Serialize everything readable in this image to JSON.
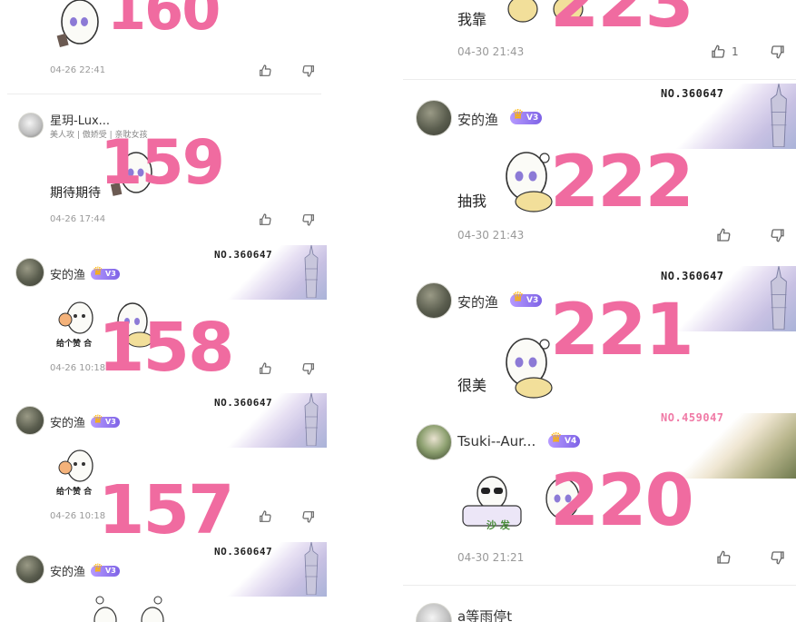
{
  "left_column": {
    "comments": [
      {
        "number": "160",
        "time": "04-26 22:41"
      },
      {
        "user": "星玥-Lux...",
        "tags": "美人攻 | 傲娇受 | 亲耽女孩",
        "text": "期待期待",
        "number": "159",
        "time": "04-26 17:44"
      },
      {
        "user": "安的渔",
        "level": "V3",
        "deco_no": "NO.360647",
        "number": "158",
        "time": "04-26 10:18",
        "sticker_text": "给个赞 合"
      },
      {
        "user": "安的渔",
        "level": "V3",
        "deco_no": "NO.360647",
        "number": "157",
        "time": "04-26 10:18",
        "sticker_text": "给个赞 合"
      },
      {
        "user": "安的渔",
        "level": "V3",
        "deco_no": "NO.360647"
      }
    ]
  },
  "right_column": {
    "comments": [
      {
        "text": "我靠",
        "number": "223",
        "time": "04-30 21:43",
        "like_count": "1"
      },
      {
        "user": "安的渔",
        "level": "V3",
        "deco_no": "NO.360647",
        "text": "抽我",
        "number": "222",
        "time": "04-30 21:43"
      },
      {
        "user": "安的渔",
        "level": "V3",
        "deco_no": "NO.360647",
        "text": "很美",
        "number": "221"
      },
      {
        "user": "Tsuki--Aur...",
        "level": "V4",
        "deco_no": "NO.459047",
        "number": "220",
        "time": "04-30 21:21",
        "sticker_text": "沙 发"
      },
      {
        "user": "a等雨停t"
      }
    ]
  },
  "icons": {
    "like": "thumbs-up-icon",
    "dislike": "thumbs-down-icon",
    "crown": "crown-icon"
  },
  "colors": {
    "number_overlay": "#f06ba0",
    "level_badge": "#8f74ee",
    "crown": "#ffb400"
  }
}
